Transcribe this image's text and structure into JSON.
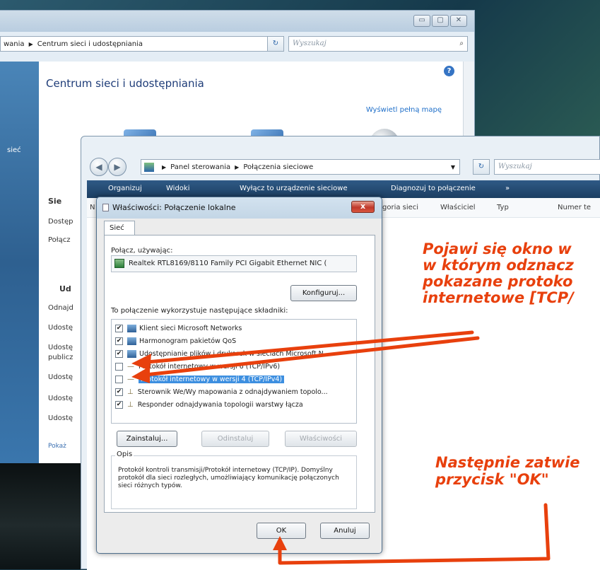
{
  "back_window": {
    "breadcrumb_prev": "wania",
    "breadcrumb_current": "Centrum sieci i udostępniania",
    "search_placeholder": "Wyszukaj",
    "heading": "Centrum sieci i udostępniania",
    "view_map_link": "Wyświetl pełną mapę",
    "left_label": "sieć",
    "tasks": [
      {
        "label": "Sie"
      },
      {
        "label": "Dostęp"
      },
      {
        "label": "Połącz"
      },
      {
        "label": "Ud"
      },
      {
        "label": "Odnajd"
      },
      {
        "label": "Udostę"
      },
      {
        "label": "Udostę"
      },
      {
        "label": "publicz"
      },
      {
        "label": "Udostę"
      },
      {
        "label": "Udostę"
      },
      {
        "label": "Udostę"
      },
      {
        "label": "Pokaż"
      }
    ]
  },
  "mid_window": {
    "breadcrumb_root": "Panel sterowania",
    "breadcrumb_current": "Połączenia sieciowe",
    "search_placeholder": "Wyszukaj",
    "toolbar": {
      "organize": "Organizuj",
      "views": "Widoki",
      "disable": "Wyłącz to urządzenie sieciowe",
      "diagnose": "Diagnozuj to połączenie",
      "more": "»"
    },
    "columns": {
      "col_n": "N",
      "category": "goria sieci",
      "owner": "Właściciel",
      "type": "Typ",
      "number": "Numer te"
    }
  },
  "dialog": {
    "title": "Właściwości: Połączenie lokalne",
    "close": "x",
    "tab": "Sieć",
    "connect_using_label": "Połącz, używając:",
    "adapter": "Realtek RTL8169/8110 Family PCI Gigabit Ethernet NIC (",
    "configure_button": "Konfiguruj...",
    "components_label": "To połączenie wykorzystuje następujące składniki:",
    "components": [
      {
        "label": "Klient sieci Microsoft Networks",
        "checked": true
      },
      {
        "label": "Harmonogram pakietów QoS",
        "checked": true
      },
      {
        "label": "Udostępnianie plików i drukarek w sieciach Microsoft N...",
        "checked": true
      },
      {
        "label": "Protokół internetowy w wersji 6 (TCP/IPv6)",
        "checked": false
      },
      {
        "label": "Protokół internetowy w wersji 4 (TCP/IPv4)",
        "checked": false,
        "selected": true
      },
      {
        "label": "Sterownik We/Wy mapowania z odnajdywaniem topolo...",
        "checked": true
      },
      {
        "label": "Responder odnajdywania topologii warstwy łącza",
        "checked": true
      }
    ],
    "install_button": "Zainstaluj...",
    "uninstall_button": "Odinstaluj",
    "properties_button": "Właściwości",
    "description_label": "Opis",
    "description": "Protokół kontroli transmisji/Protokół internetowy (TCP/IP). Domyślny protokół dla sieci rozległych, umożliwiający komunikację połączonych sieci różnych typów.",
    "ok_button": "OK",
    "cancel_button": "Anuluj"
  },
  "annotations": {
    "top_lines": [
      "Pojawi się okno w",
      "w którym odznacz",
      "pokazane protoko",
      "internetowe [TCP/"
    ],
    "bottom_lines": [
      "Następnie zatwie",
      "przycisk \"OK\""
    ],
    "color": "#e8400d"
  }
}
